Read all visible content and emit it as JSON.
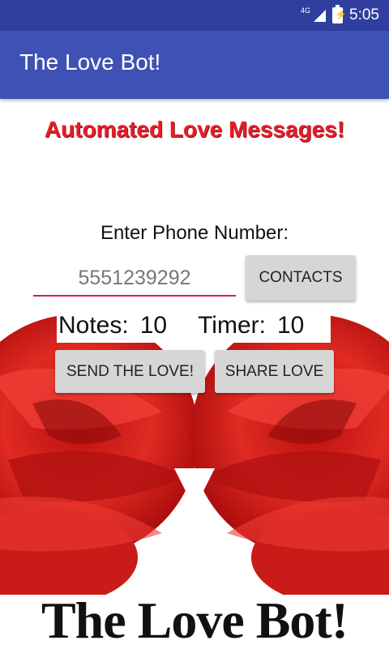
{
  "status_bar": {
    "network": "4G",
    "time": "5:05"
  },
  "app_bar": {
    "title": "The Love Bot!"
  },
  "headline": "Automated Love Messages!",
  "phone": {
    "label": "Enter Phone Number:",
    "value": "5551239292"
  },
  "buttons": {
    "contacts": "CONTACTS",
    "send": "SEND THE LOVE!",
    "share": "SHARE LOVE"
  },
  "counters": {
    "notes_label": "Notes:",
    "notes_value": "10",
    "timer_label": "Timer:",
    "timer_value": "10"
  },
  "banner": {
    "text": "The Love Bot!"
  },
  "colors": {
    "status_bar": "#303f9f",
    "app_bar": "#3f51b5",
    "headline": "#e31e2a",
    "input_underline": "#d81b60",
    "rose": "#d9231f"
  }
}
